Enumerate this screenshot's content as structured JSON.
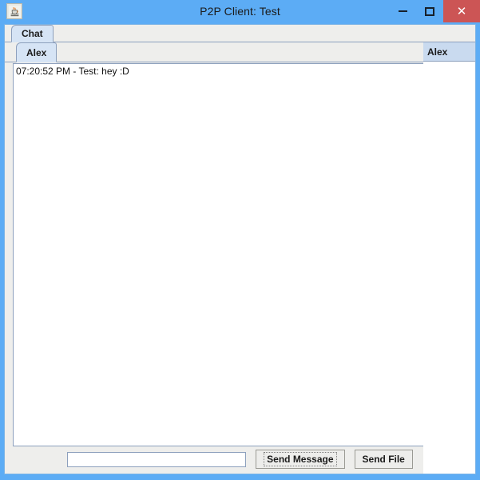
{
  "window": {
    "title": "P2P Client: Test",
    "icon": "java-coffee-cup-icon",
    "controls": {
      "minimize": "–",
      "maximize": "❐",
      "close": "✕"
    },
    "colors": {
      "titlebar": "#5cacf5",
      "close_button": "#cc5555",
      "panel": "#eeeeec",
      "tab_selected": "#d6e4f5",
      "table_header": "#c9daef",
      "border": "#8da0bd"
    }
  },
  "outer_tabs": [
    {
      "label": "Chat",
      "selected": true
    }
  ],
  "inner_tabs": [
    {
      "label": "Alex",
      "selected": true
    }
  ],
  "user_list": {
    "header": "Alex",
    "rows": []
  },
  "chat": {
    "messages": [
      "07:20:52 PM - Test: hey :D"
    ]
  },
  "compose": {
    "input_value": "",
    "input_placeholder": "",
    "send_message_label": "Send Message",
    "send_file_label": "Send File"
  }
}
